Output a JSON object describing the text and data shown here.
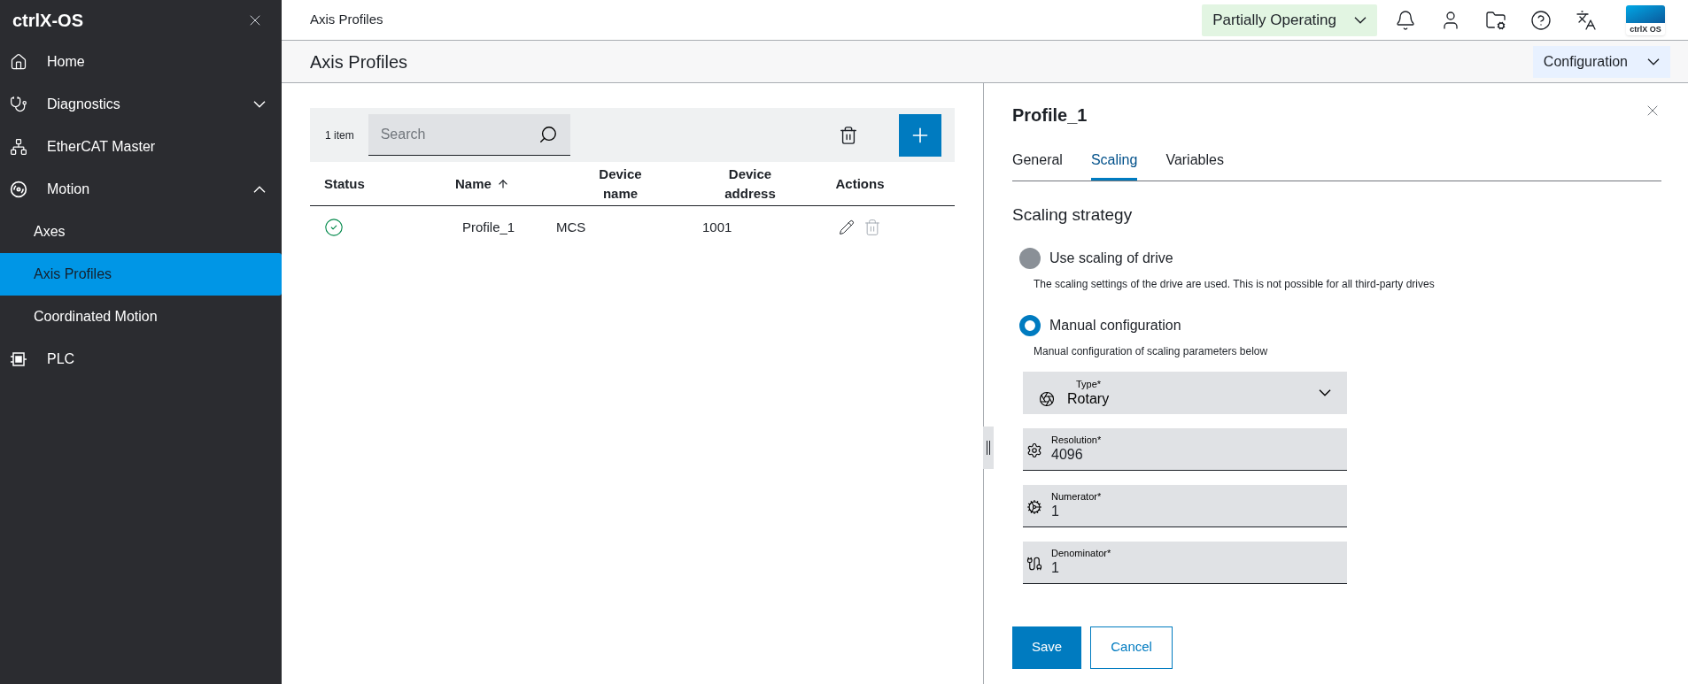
{
  "sidebar": {
    "brand": "ctrlX-OS",
    "items": [
      {
        "label": "Home",
        "kind": "link",
        "selected": false
      },
      {
        "label": "Diagnostics",
        "kind": "group",
        "selected": false,
        "expanded": false
      },
      {
        "label": "EtherCAT Master",
        "kind": "link",
        "selected": false
      },
      {
        "label": "Motion",
        "kind": "group",
        "selected": false,
        "expanded": true,
        "children": [
          {
            "label": "Axes",
            "selected": false
          },
          {
            "label": "Axis Profiles",
            "selected": true
          },
          {
            "label": "Coordinated Motion",
            "selected": false
          }
        ]
      },
      {
        "label": "PLC",
        "kind": "link",
        "selected": false
      }
    ]
  },
  "header": {
    "breadcrumb": "Axis Profiles",
    "status": "Partially Operating",
    "logo_text": "ctrlX OS"
  },
  "page": {
    "title": "Axis Profiles",
    "mode": "Configuration"
  },
  "table": {
    "count": "1 item",
    "search": {
      "placeholder": "Search"
    },
    "columns": [
      {
        "label": "Status",
        "sorted": false
      },
      {
        "label": "Name",
        "sorted": true
      },
      {
        "label": "Device name",
        "sorted": false
      },
      {
        "label": "Device address",
        "sorted": false
      },
      {
        "label": "Actions",
        "sorted": false
      }
    ],
    "rows": [
      {
        "status_ok": true,
        "name": "Profile_1",
        "device_name": "MCS",
        "device_address": "1001"
      }
    ]
  },
  "panel": {
    "title": "Profile_1",
    "tabs": [
      {
        "label": "General",
        "selected": false
      },
      {
        "label": "Scaling",
        "selected": true
      },
      {
        "label": "Variables",
        "selected": false
      }
    ],
    "section": "Scaling strategy",
    "options": [
      {
        "label": "Use scaling of drive",
        "description": "The scaling settings of the drive are used. This is not possible for all third-party drives",
        "selected": false
      },
      {
        "label": "Manual configuration",
        "description": "Manual configuration of scaling parameters below",
        "selected": true
      }
    ],
    "fields": [
      {
        "kind": "select",
        "label": "Type*",
        "value": "Rotary"
      },
      {
        "kind": "input",
        "label": "Resolution*",
        "value": "4096"
      },
      {
        "kind": "input",
        "label": "Numerator*",
        "value": "1"
      },
      {
        "kind": "input",
        "label": "Denominator*",
        "value": "1"
      }
    ],
    "buttons": [
      "Save",
      "Cancel"
    ]
  }
}
